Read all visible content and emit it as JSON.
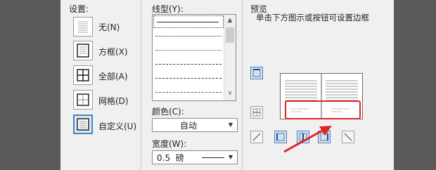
{
  "settings": {
    "title": "设置:",
    "items": [
      {
        "label": "无(N)",
        "icon": "border-none-icon"
      },
      {
        "label": "方框(X)",
        "icon": "border-box-icon"
      },
      {
        "label": "全部(A)",
        "icon": "border-all-icon"
      },
      {
        "label": "网格(D)",
        "icon": "border-grid-icon"
      },
      {
        "label": "自定义(U)",
        "icon": "border-custom-icon",
        "selected": true
      }
    ]
  },
  "line_style": {
    "title": "线型(Y):",
    "scroll_up": "▲",
    "scroll_down": "∨"
  },
  "color": {
    "title": "颜色(C):",
    "value": "自动",
    "arrow": "▼"
  },
  "width": {
    "title": "宽度(W):",
    "value": "0.5  磅",
    "arrow": "▼"
  },
  "preview": {
    "title": "预览",
    "instructions": "单击下方图示或按钮可设置边框"
  },
  "colors": {
    "dialog_bg": "#f0f0f0",
    "selection": "#cfe3f7",
    "annotation": "#e02323"
  }
}
